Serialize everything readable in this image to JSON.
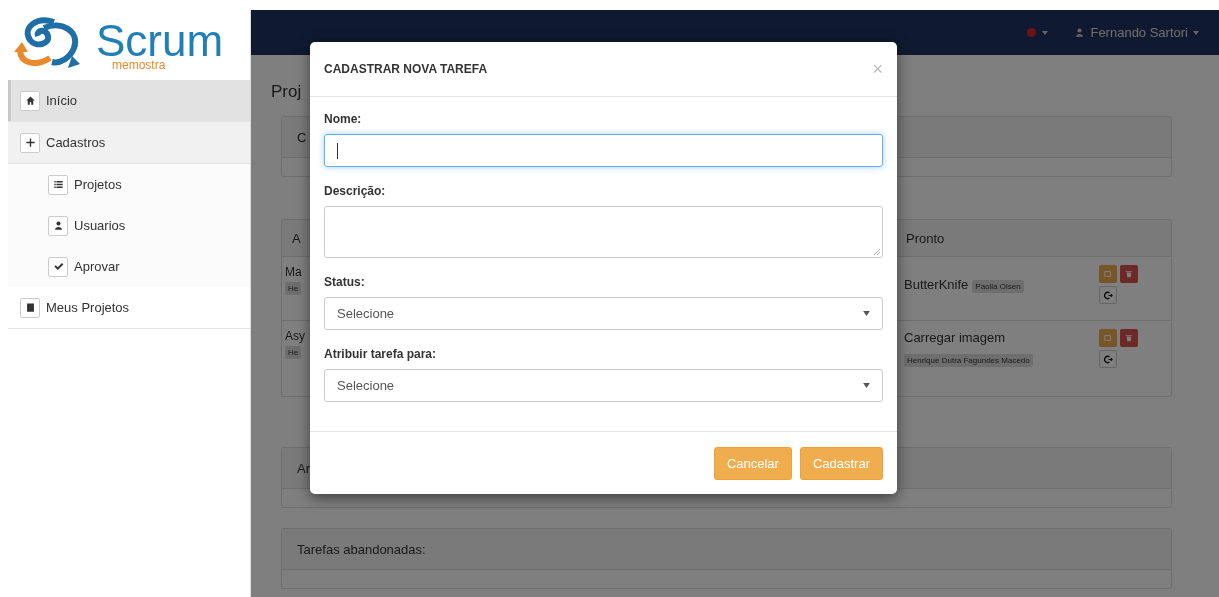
{
  "logo": {
    "title": "Scrum",
    "subtitle": "memostra"
  },
  "sidebar": {
    "items": [
      {
        "label": "Início",
        "selected": true
      },
      {
        "label": "Cadastros",
        "selected": false,
        "expanded": true,
        "children": [
          {
            "label": "Projetos",
            "selected": false
          },
          {
            "label": "Usuarios",
            "selected": false
          },
          {
            "label": "Aprovar",
            "selected": false
          }
        ]
      },
      {
        "label": "Meus Projetos",
        "selected": false
      }
    ]
  },
  "navbar": {
    "user": "Fernando Sartori"
  },
  "page": {
    "title": "Proj",
    "panel_1": {
      "heading": "C"
    },
    "board": {
      "columns": [
        {
          "heading": "A",
          "tasks": [
            {
              "title": "Ma",
              "assignee": "He"
            },
            {
              "title": "Asy",
              "assignee": "He"
            }
          ]
        },
        {
          "heading": "Pronto",
          "tasks": [
            {
              "title": "ButterKnife",
              "assignee": "Paolla Olsen"
            },
            {
              "title": "Carregar imagem",
              "assignee": "Henrique Dutra Fagundes Macedo"
            }
          ]
        }
      ]
    },
    "panel_2": {
      "heading": "Ar"
    },
    "panel_3": {
      "heading": "Tarefas abandonadas:"
    }
  },
  "modal": {
    "title": "CADASTRAR NOVA TAREFA",
    "close": "×",
    "fields": [
      {
        "label": "Nome:",
        "kind": "input",
        "focused": true
      },
      {
        "label": "Descrição:",
        "kind": "textarea",
        "focused": false
      },
      {
        "label": "Status:",
        "kind": "select",
        "value": "Selecione",
        "focused": false
      },
      {
        "label": "Atribuir tarefa para:",
        "kind": "select",
        "value": "Selecione",
        "focused": false
      }
    ],
    "buttons": [
      "Cancelar",
      "Cadastrar"
    ]
  }
}
